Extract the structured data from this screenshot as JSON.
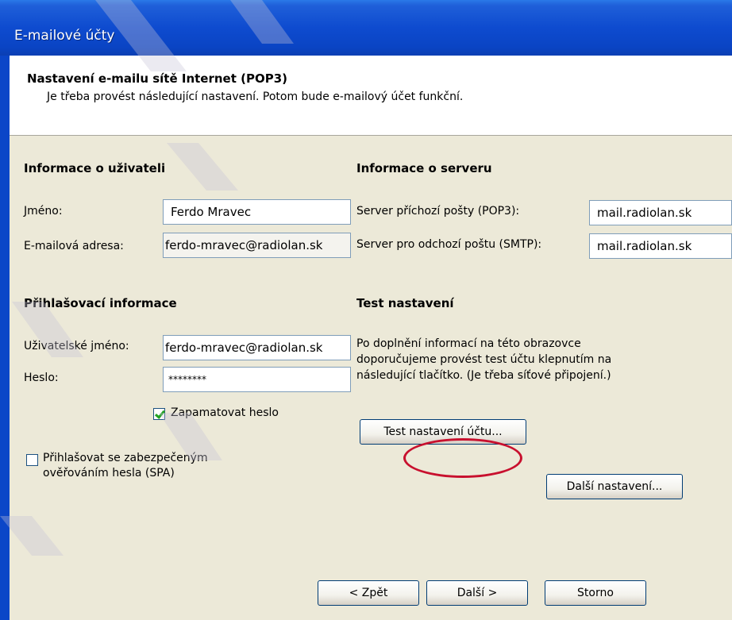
{
  "window": {
    "title": "E-mailové účty"
  },
  "header": {
    "title": "Nastavení e-mailu sítě Internet (POP3)",
    "subtitle": "Je třeba provést následující nastavení. Potom bude e-mailový účet funkční."
  },
  "user_info": {
    "section_title": "Informace o uživateli",
    "name_label": "Jméno:",
    "name_value": "Ferdo Mravec",
    "email_label": "E-mailová adresa:",
    "email_value": "ferdo-mravec@radiolan.sk"
  },
  "server_info": {
    "section_title": "Informace o serveru",
    "incoming_label": "Server příchozí pošty (POP3):",
    "incoming_value": "mail.radiolan.sk",
    "outgoing_label": "Server pro odchozí poštu (SMTP):",
    "outgoing_value": "mail.radiolan.sk"
  },
  "login_info": {
    "section_title": "Přihlašovací informace",
    "username_label": "Uživatelské jméno:",
    "username_value": "ferdo-mravec@radiolan.sk",
    "password_label": "Heslo:",
    "password_value": "********",
    "remember_label": "Zapamatovat heslo",
    "remember_checked": true,
    "spa_label_line1": "Přihlašovat se zabezpečeným",
    "spa_label_line2": "ověřováním hesla (SPA)",
    "spa_checked": false
  },
  "test_settings": {
    "section_title": "Test nastavení",
    "desc_line1": "Po doplnění informací na této obrazovce",
    "desc_line2": "doporučujeme provést test účtu klepnutím na",
    "desc_line3": "následující tlačítko. (Je třeba síťové připojení.)",
    "test_button": "Test nastavení účtu...",
    "more_button": "Další nastavení..."
  },
  "footer": {
    "back_button": "< Zpět",
    "next_button": "Další >",
    "cancel_button": "Storno"
  },
  "colors": {
    "titlebar": "#0e4bcf",
    "dialog_background": "#ece9d8",
    "highlight_ellipse": "#c8102e",
    "checkmark": "#21a121"
  }
}
